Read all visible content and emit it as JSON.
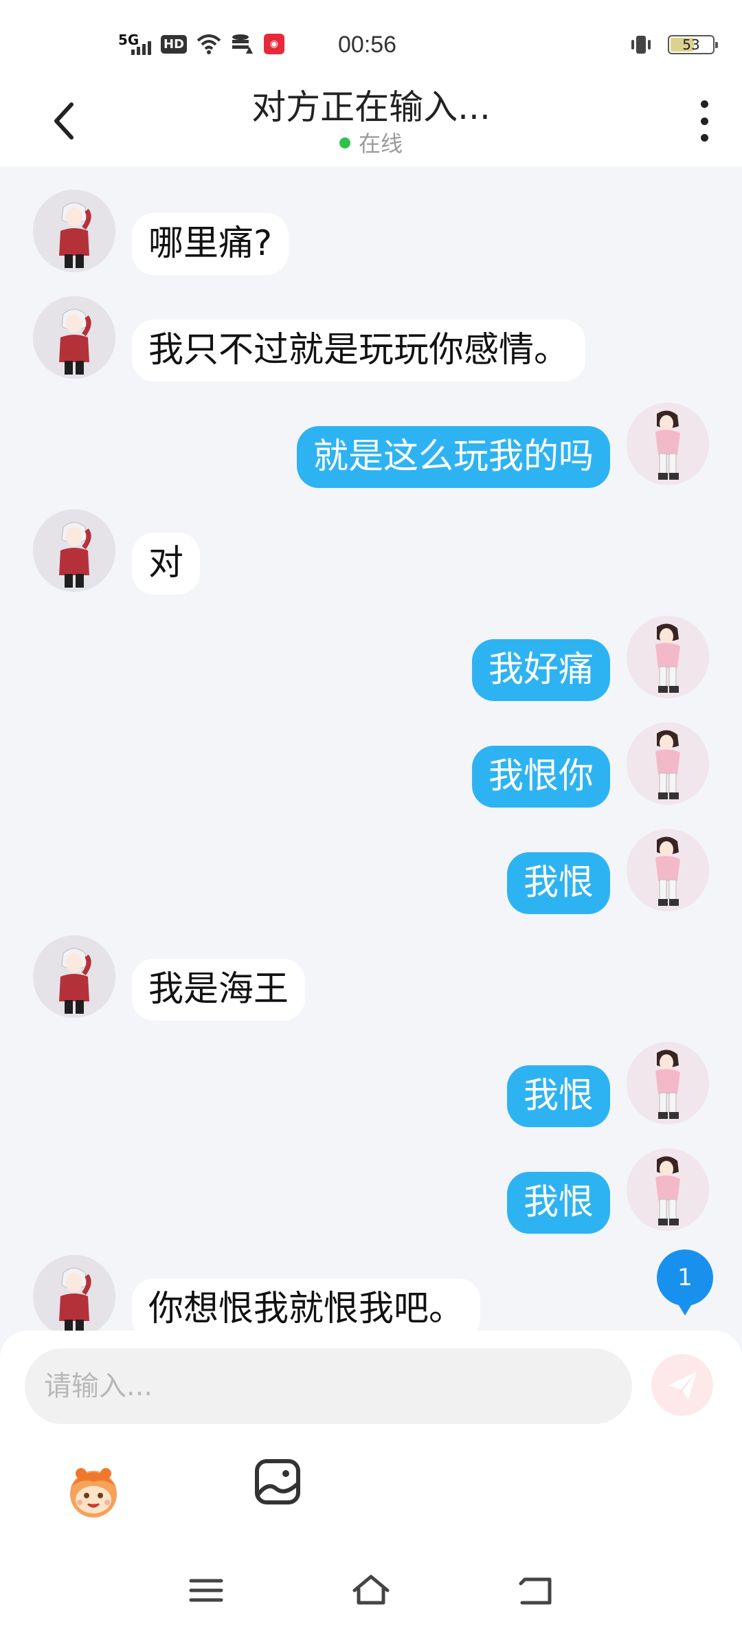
{
  "status_bar": {
    "network": "5G",
    "hd": "HD",
    "time": "00:56",
    "battery": "53"
  },
  "header": {
    "title": "对方正在输入...",
    "status": "在线"
  },
  "messages": [
    {
      "side": "left",
      "text": "哪里痛?"
    },
    {
      "side": "left",
      "text": "我只不过就是玩玩你感情。"
    },
    {
      "side": "right",
      "text": "就是这么玩我的吗"
    },
    {
      "side": "left",
      "text": "对"
    },
    {
      "side": "right",
      "text": "我好痛"
    },
    {
      "side": "right",
      "text": "我恨你"
    },
    {
      "side": "right",
      "text": "我恨"
    },
    {
      "side": "left",
      "text": "我是海王"
    },
    {
      "side": "right",
      "text": "我恨"
    },
    {
      "side": "right",
      "text": "我恨"
    },
    {
      "side": "left",
      "text": "你想恨我就恨我吧。"
    }
  ],
  "unread_badge": "1",
  "composer": {
    "placeholder": "请输入..."
  },
  "colors": {
    "outgoing_bubble": "#2eb3f2",
    "incoming_bubble": "#ffffff",
    "background": "#f3f5f8",
    "online_dot": "#2fc24a",
    "badge": "#1891ee"
  },
  "icons": [
    "back-icon",
    "more-icon",
    "send-icon",
    "emoji-icon",
    "image-icon",
    "menu-icon",
    "home-icon",
    "return-icon"
  ]
}
